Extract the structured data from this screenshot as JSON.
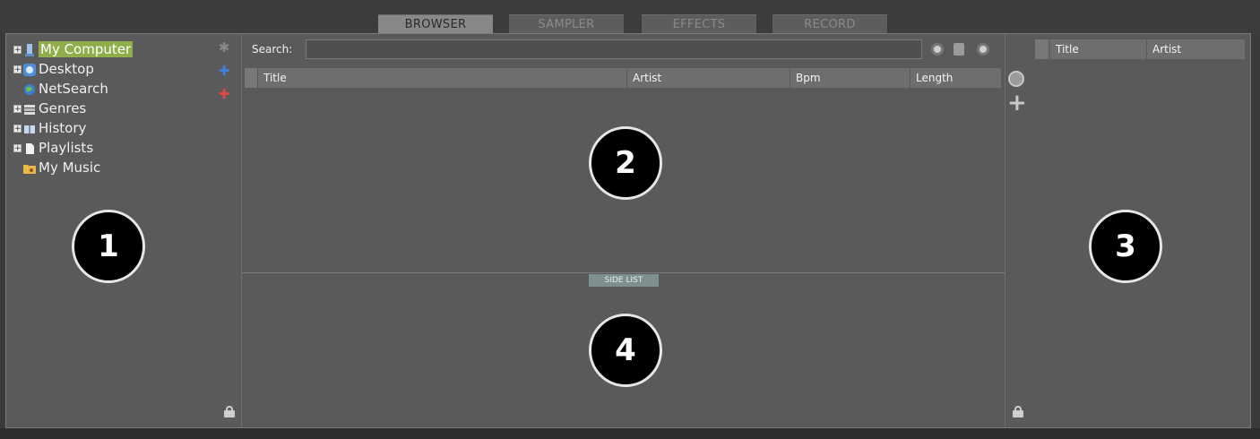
{
  "tabs": [
    {
      "label": "BROWSER",
      "active": true
    },
    {
      "label": "SAMPLER",
      "active": false
    },
    {
      "label": "EFFECTS",
      "active": false
    },
    {
      "label": "RECORD",
      "active": false
    }
  ],
  "tree": {
    "items": [
      {
        "label": "My Computer",
        "expandable": true,
        "selected": true,
        "icon": "computer-icon"
      },
      {
        "label": "Desktop",
        "expandable": true,
        "selected": false,
        "icon": "desktop-icon"
      },
      {
        "label": "NetSearch",
        "expandable": false,
        "selected": false,
        "icon": "globe-icon"
      },
      {
        "label": "Genres",
        "expandable": true,
        "selected": false,
        "icon": "stack-icon"
      },
      {
        "label": "History",
        "expandable": true,
        "selected": false,
        "icon": "book-icon"
      },
      {
        "label": "Playlists",
        "expandable": true,
        "selected": false,
        "icon": "document-icon"
      },
      {
        "label": "My Music",
        "expandable": false,
        "selected": false,
        "icon": "music-folder-icon"
      }
    ]
  },
  "search": {
    "label": "Search:",
    "value": ""
  },
  "file_list": {
    "columns": [
      "Title",
      "Artist",
      "Bpm",
      "Length"
    ]
  },
  "side_list": {
    "label": "SIDE LIST"
  },
  "right_list": {
    "columns": [
      "Title",
      "Artist"
    ]
  },
  "badges": [
    "1",
    "2",
    "3",
    "4"
  ],
  "colors": {
    "selection": "#8fae4a",
    "panel": "#5a5a5a",
    "header": "#6e6e6e",
    "sidelist": "#7d9090"
  }
}
